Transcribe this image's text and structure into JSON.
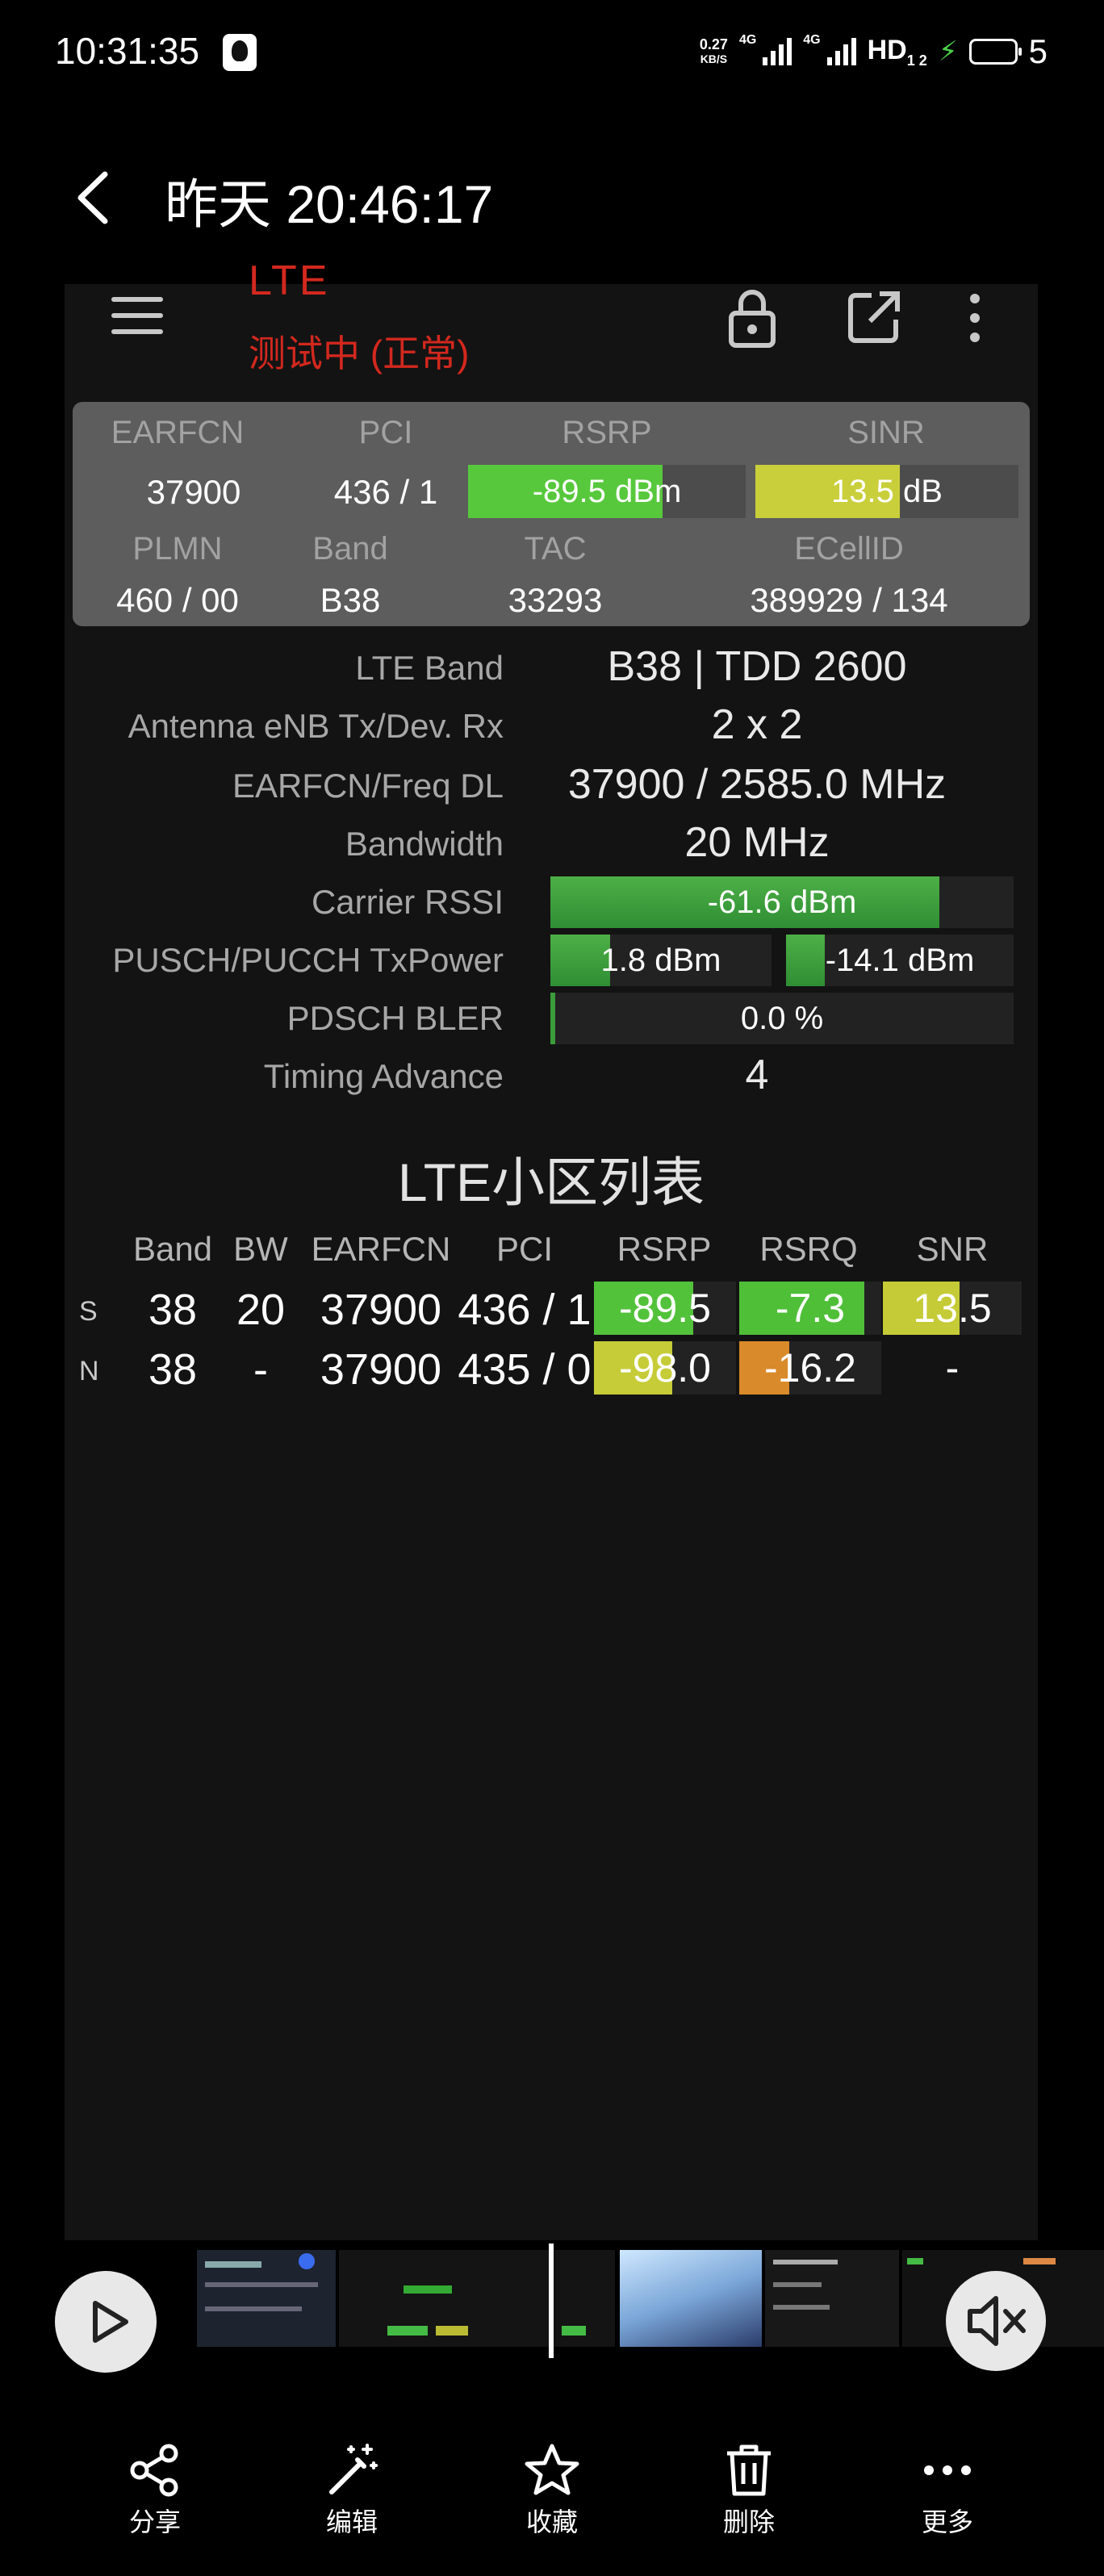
{
  "status_bar": {
    "time": "10:31:35",
    "net_speed_value": "0.27",
    "net_speed_unit": "KB/S",
    "net1": "4G",
    "net2": "4G",
    "hd": "HD",
    "hd_sub": "1 2",
    "battery_level": "5"
  },
  "header": {
    "title": "昨天 20:46:17"
  },
  "app": {
    "title": "LTE",
    "status": "测试中 (正常)"
  },
  "summary": {
    "headers_row1": [
      "EARFCN",
      "PCI",
      "RSRP",
      "SINR"
    ],
    "earfcn": "37900",
    "pci": "436 / 1",
    "rsrp": {
      "text": "-89.5 dBm",
      "fill_fraction": 0.7,
      "color": "#57c83c"
    },
    "sinr": {
      "text": "13.5 dB",
      "fill_fraction": 0.55,
      "color": "#c9cf3a"
    },
    "headers_row2": [
      "PLMN",
      "Band",
      "TAC",
      "ECellID"
    ],
    "plmn": "460 / 00",
    "band": "B38",
    "tac": "33293",
    "ecellid": "389929 / 134"
  },
  "details": {
    "lte_band": {
      "label": "LTE Band",
      "value": "B38 | TDD 2600"
    },
    "antenna": {
      "label": "Antenna eNB Tx/Dev. Rx",
      "value": "2 x 2"
    },
    "earfcn_freq": {
      "label": "EARFCN/Freq DL",
      "value": "37900 / 2585.0 MHz"
    },
    "bandwidth": {
      "label": "Bandwidth",
      "value": "20 MHz"
    },
    "rssi": {
      "label": "Carrier RSSI",
      "value": "-61.6 dBm",
      "fill_fraction": 0.84
    },
    "txpower": {
      "label": "PUSCH/PUCCH TxPower",
      "pusch": "1.8 dBm",
      "pusch_fill": 0.27,
      "pucch": "-14.1 dBm",
      "pucch_fill": 0.17
    },
    "bler": {
      "label": "PDSCH BLER",
      "value": "0.0 %",
      "fill_fraction": 0.01
    },
    "timing_advance": {
      "label": "Timing Advance",
      "value": "4"
    }
  },
  "cell_list": {
    "title": "LTE小区列表",
    "headers": [
      "Band",
      "BW",
      "EARFCN",
      "PCI",
      "RSRP",
      "RSRQ",
      "SNR"
    ],
    "rows": [
      {
        "type": "S",
        "band": "38",
        "bw": "20",
        "earfcn": "37900",
        "pci": "436 / 1",
        "rsrp": "-89.5",
        "rsrp_fill": 0.7,
        "rsrp_color": "#52c23a",
        "rsrq": "-7.3",
        "rsrq_fill": 0.88,
        "rsrq_color": "#4fbf38",
        "snr": "13.5",
        "snr_fill": 0.55,
        "snr_color": "#c4cb36"
      },
      {
        "type": "N",
        "band": "38",
        "bw": "-",
        "earfcn": "37900",
        "pci": "435 / 0",
        "rsrp": "-98.0",
        "rsrp_fill": 0.55,
        "rsrp_color": "#c6cc38",
        "rsrq": "-16.2",
        "rsrq_fill": 0.35,
        "rsrq_color": "#d98a2a",
        "snr": "-",
        "snr_fill": 0,
        "snr_color": "#222222"
      }
    ]
  },
  "toolbar": {
    "share": "分享",
    "edit": "编辑",
    "favorite": "收藏",
    "delete": "删除",
    "more": "更多"
  }
}
